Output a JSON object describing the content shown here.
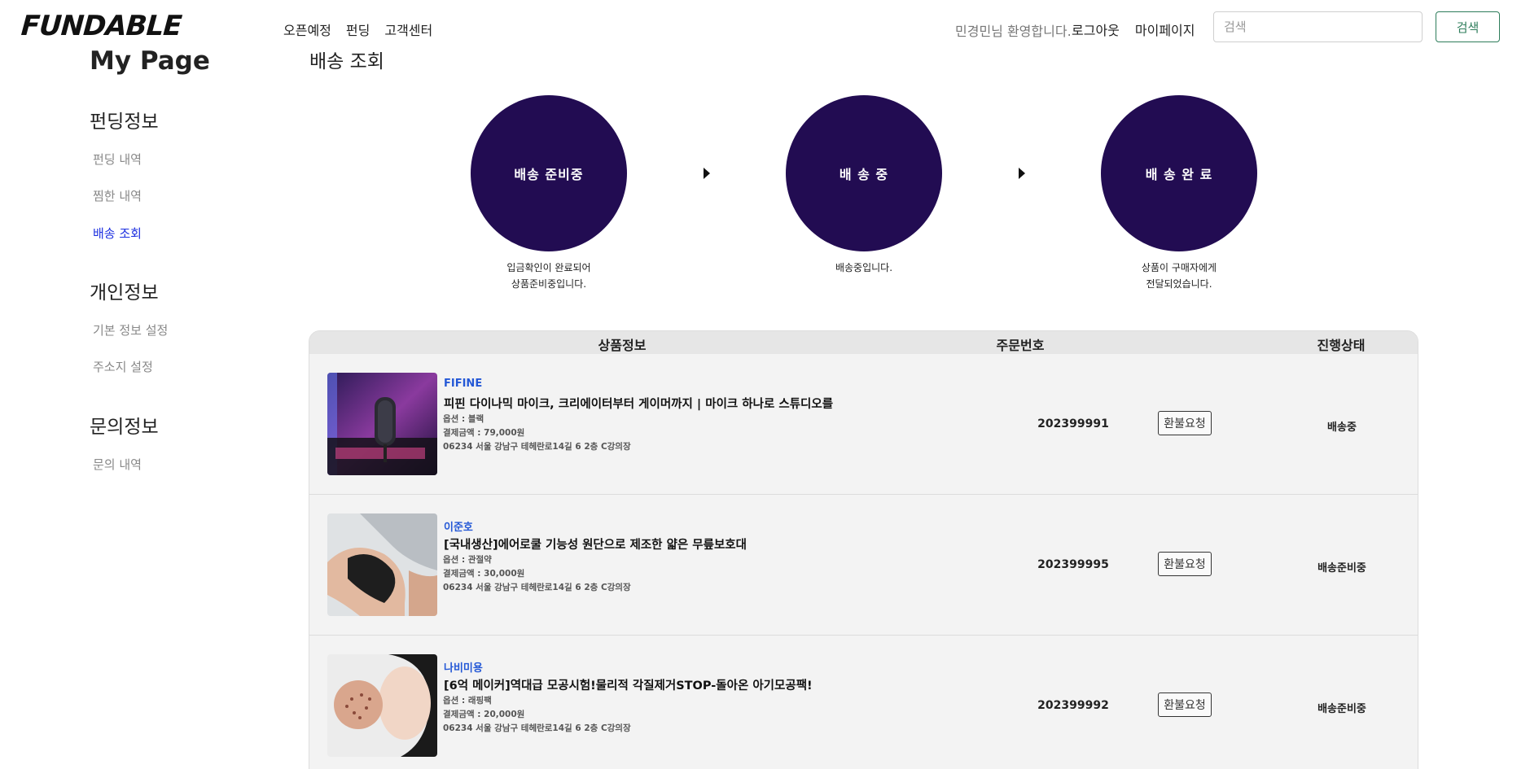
{
  "header": {
    "logo": "FUNDABLE",
    "nav": [
      "오픈예정",
      "펀딩",
      "고객센터"
    ],
    "welcome": "민경민님 환영합니다.",
    "logout": "로그아웃",
    "mypage": "마이페이지",
    "search_placeholder": "검색",
    "search_button": "검색"
  },
  "sidebar": {
    "title": "My Page",
    "sections": [
      {
        "title": "펀딩정보",
        "items": [
          "펀딩 내역",
          "찜한 내역",
          "배송 조회"
        ]
      },
      {
        "title": "개인정보",
        "items": [
          "기본 정보 설정",
          "주소지 설정"
        ]
      },
      {
        "title": "문의정보",
        "items": [
          "문의 내역"
        ]
      }
    ],
    "active_item": "배송 조회"
  },
  "main": {
    "heading": "배송 조회",
    "steps": [
      {
        "label": "배송 준비중",
        "desc_line1": "입금확인이 완료되어",
        "desc_line2": "상품준비중입니다."
      },
      {
        "label": "배 송 중",
        "desc_line1": "배송중입니다.",
        "desc_line2": ""
      },
      {
        "label": "배 송 완 료",
        "desc_line1": "상품이 구매자에게",
        "desc_line2": "전달되었습니다."
      }
    ],
    "colors": {
      "step_circle": "#220c52",
      "brand_text": "#2458d6",
      "active_menu": "#1c2fe0"
    },
    "table": {
      "headers": {
        "product": "상품정보",
        "order_no": "주문번호",
        "status": "진행상태"
      },
      "refund_label": "환불요청",
      "rows": [
        {
          "image": "microphone-photo",
          "brand": "FIFINE",
          "name": "피핀 다이나믹 마이크, 크리에이터부터 게이머까지 | 마이크 하나로 스튜디오를",
          "option": "옵션 : 블랙",
          "price": "결제금액 : 79,000원",
          "address": "06234 서울 강남구 테헤란로14길 6 2층 C강의장",
          "order_no": "202399991",
          "status": "배송중"
        },
        {
          "image": "knee-support-photo",
          "brand": "이준호",
          "name": "[국내생산]에어로쿨 기능성 원단으로 제조한 얇은 무릎보호대",
          "option": "옵션 : 관절약",
          "price": "결제금액 : 30,000원",
          "address": "06234 서울 강남구 테헤란로14길 6 2층 C강의장",
          "order_no": "202399995",
          "status": "배송준비중"
        },
        {
          "image": "pore-pack-photo",
          "brand": "나비미용",
          "name": "[6억 메이커]역대급 모공시험!물리적 각질제거STOP-돌아온 아기모공팩!",
          "option": "옵션 : 래핑팩",
          "price": "결제금액 : 20,000원",
          "address": "06234 서울 강남구 테헤란로14길 6 2층 C강의장",
          "order_no": "202399992",
          "status": "배송준비중"
        }
      ]
    }
  }
}
